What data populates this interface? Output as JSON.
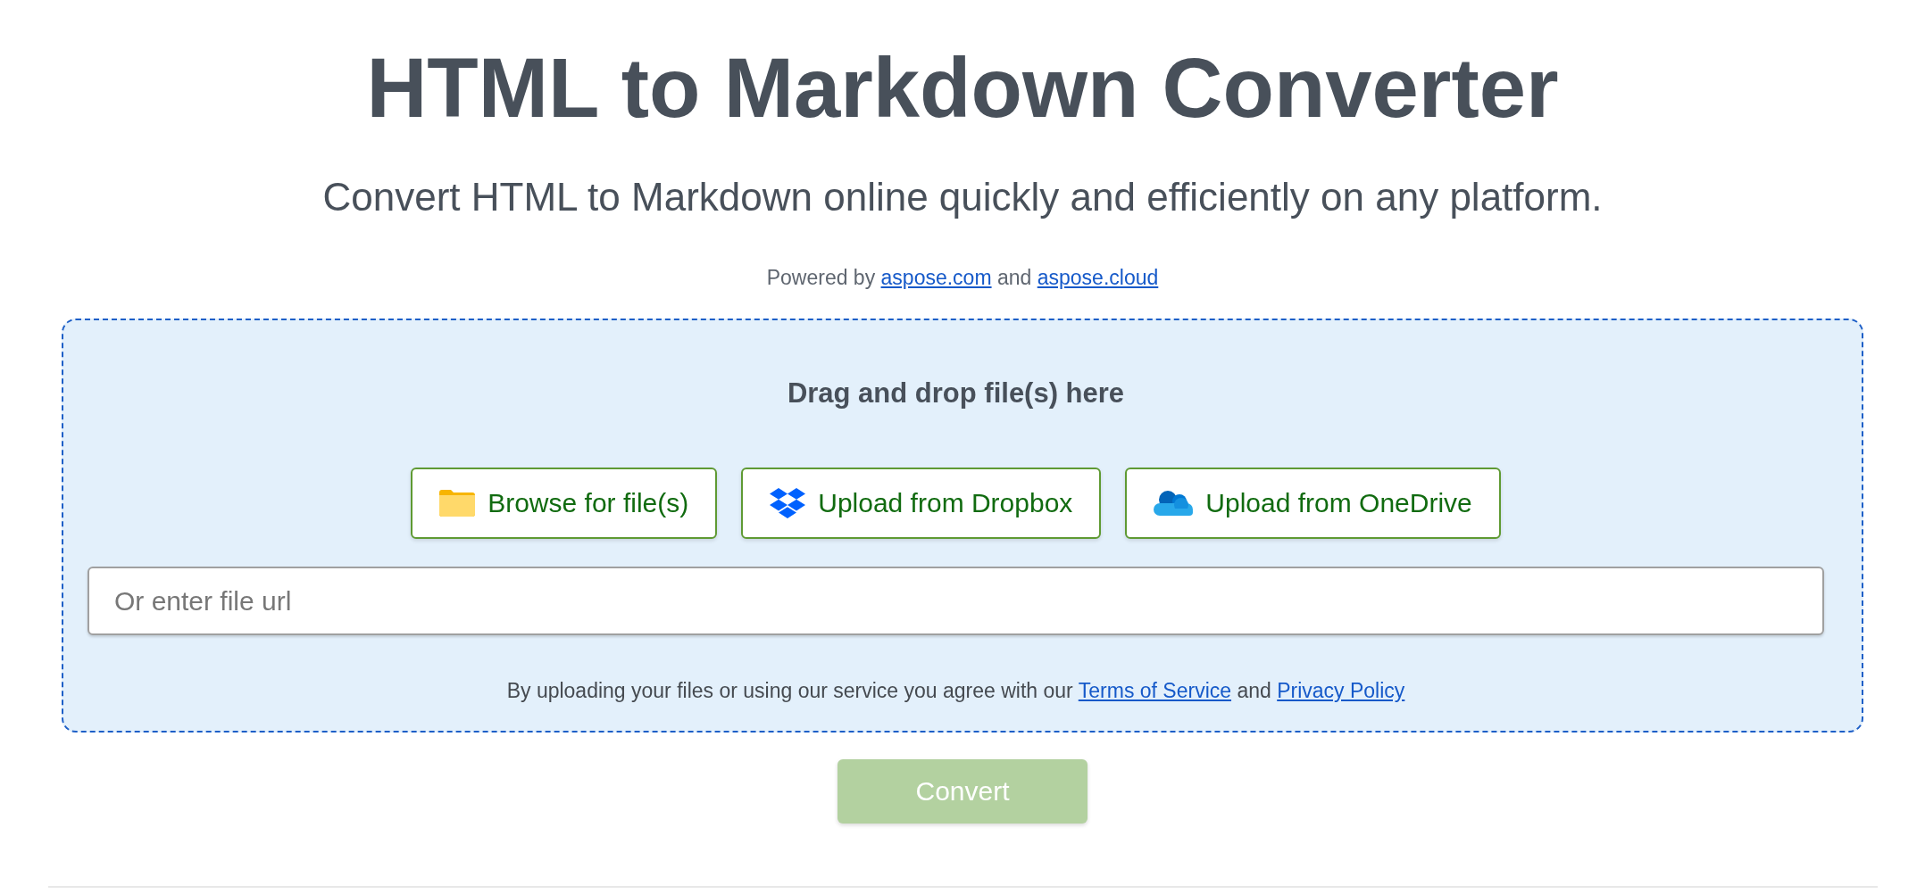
{
  "header": {
    "title": "HTML to Markdown Converter",
    "subtitle": "Convert HTML to Markdown online quickly and efficiently on any platform.",
    "powered_by": [
      {
        "kind": "text",
        "text": "Powered by"
      },
      {
        "kind": "link",
        "text": "aspose.com"
      },
      {
        "kind": "text",
        "text": "and"
      },
      {
        "kind": "link",
        "text": "aspose.cloud"
      }
    ]
  },
  "upload": {
    "heading": "Drag and drop file(s) here",
    "buttons": [
      {
        "kind": "folder",
        "label": "Browse for file(s)"
      },
      {
        "kind": "dropbox",
        "label": "Upload from Dropbox"
      },
      {
        "kind": "onedrive",
        "label": "Upload from OneDrive"
      }
    ],
    "url_field": {
      "placeholder": "Or enter file url"
    },
    "agreement": [
      {
        "kind": "text",
        "text": "By uploading your files or using our service you agree with our"
      },
      {
        "kind": "link",
        "text": "Terms of Service"
      },
      {
        "kind": "text",
        "text": "and"
      },
      {
        "kind": "link",
        "text": "Privacy Policy"
      }
    ]
  },
  "convert_button": {
    "label": "Convert",
    "disabled": true
  }
}
